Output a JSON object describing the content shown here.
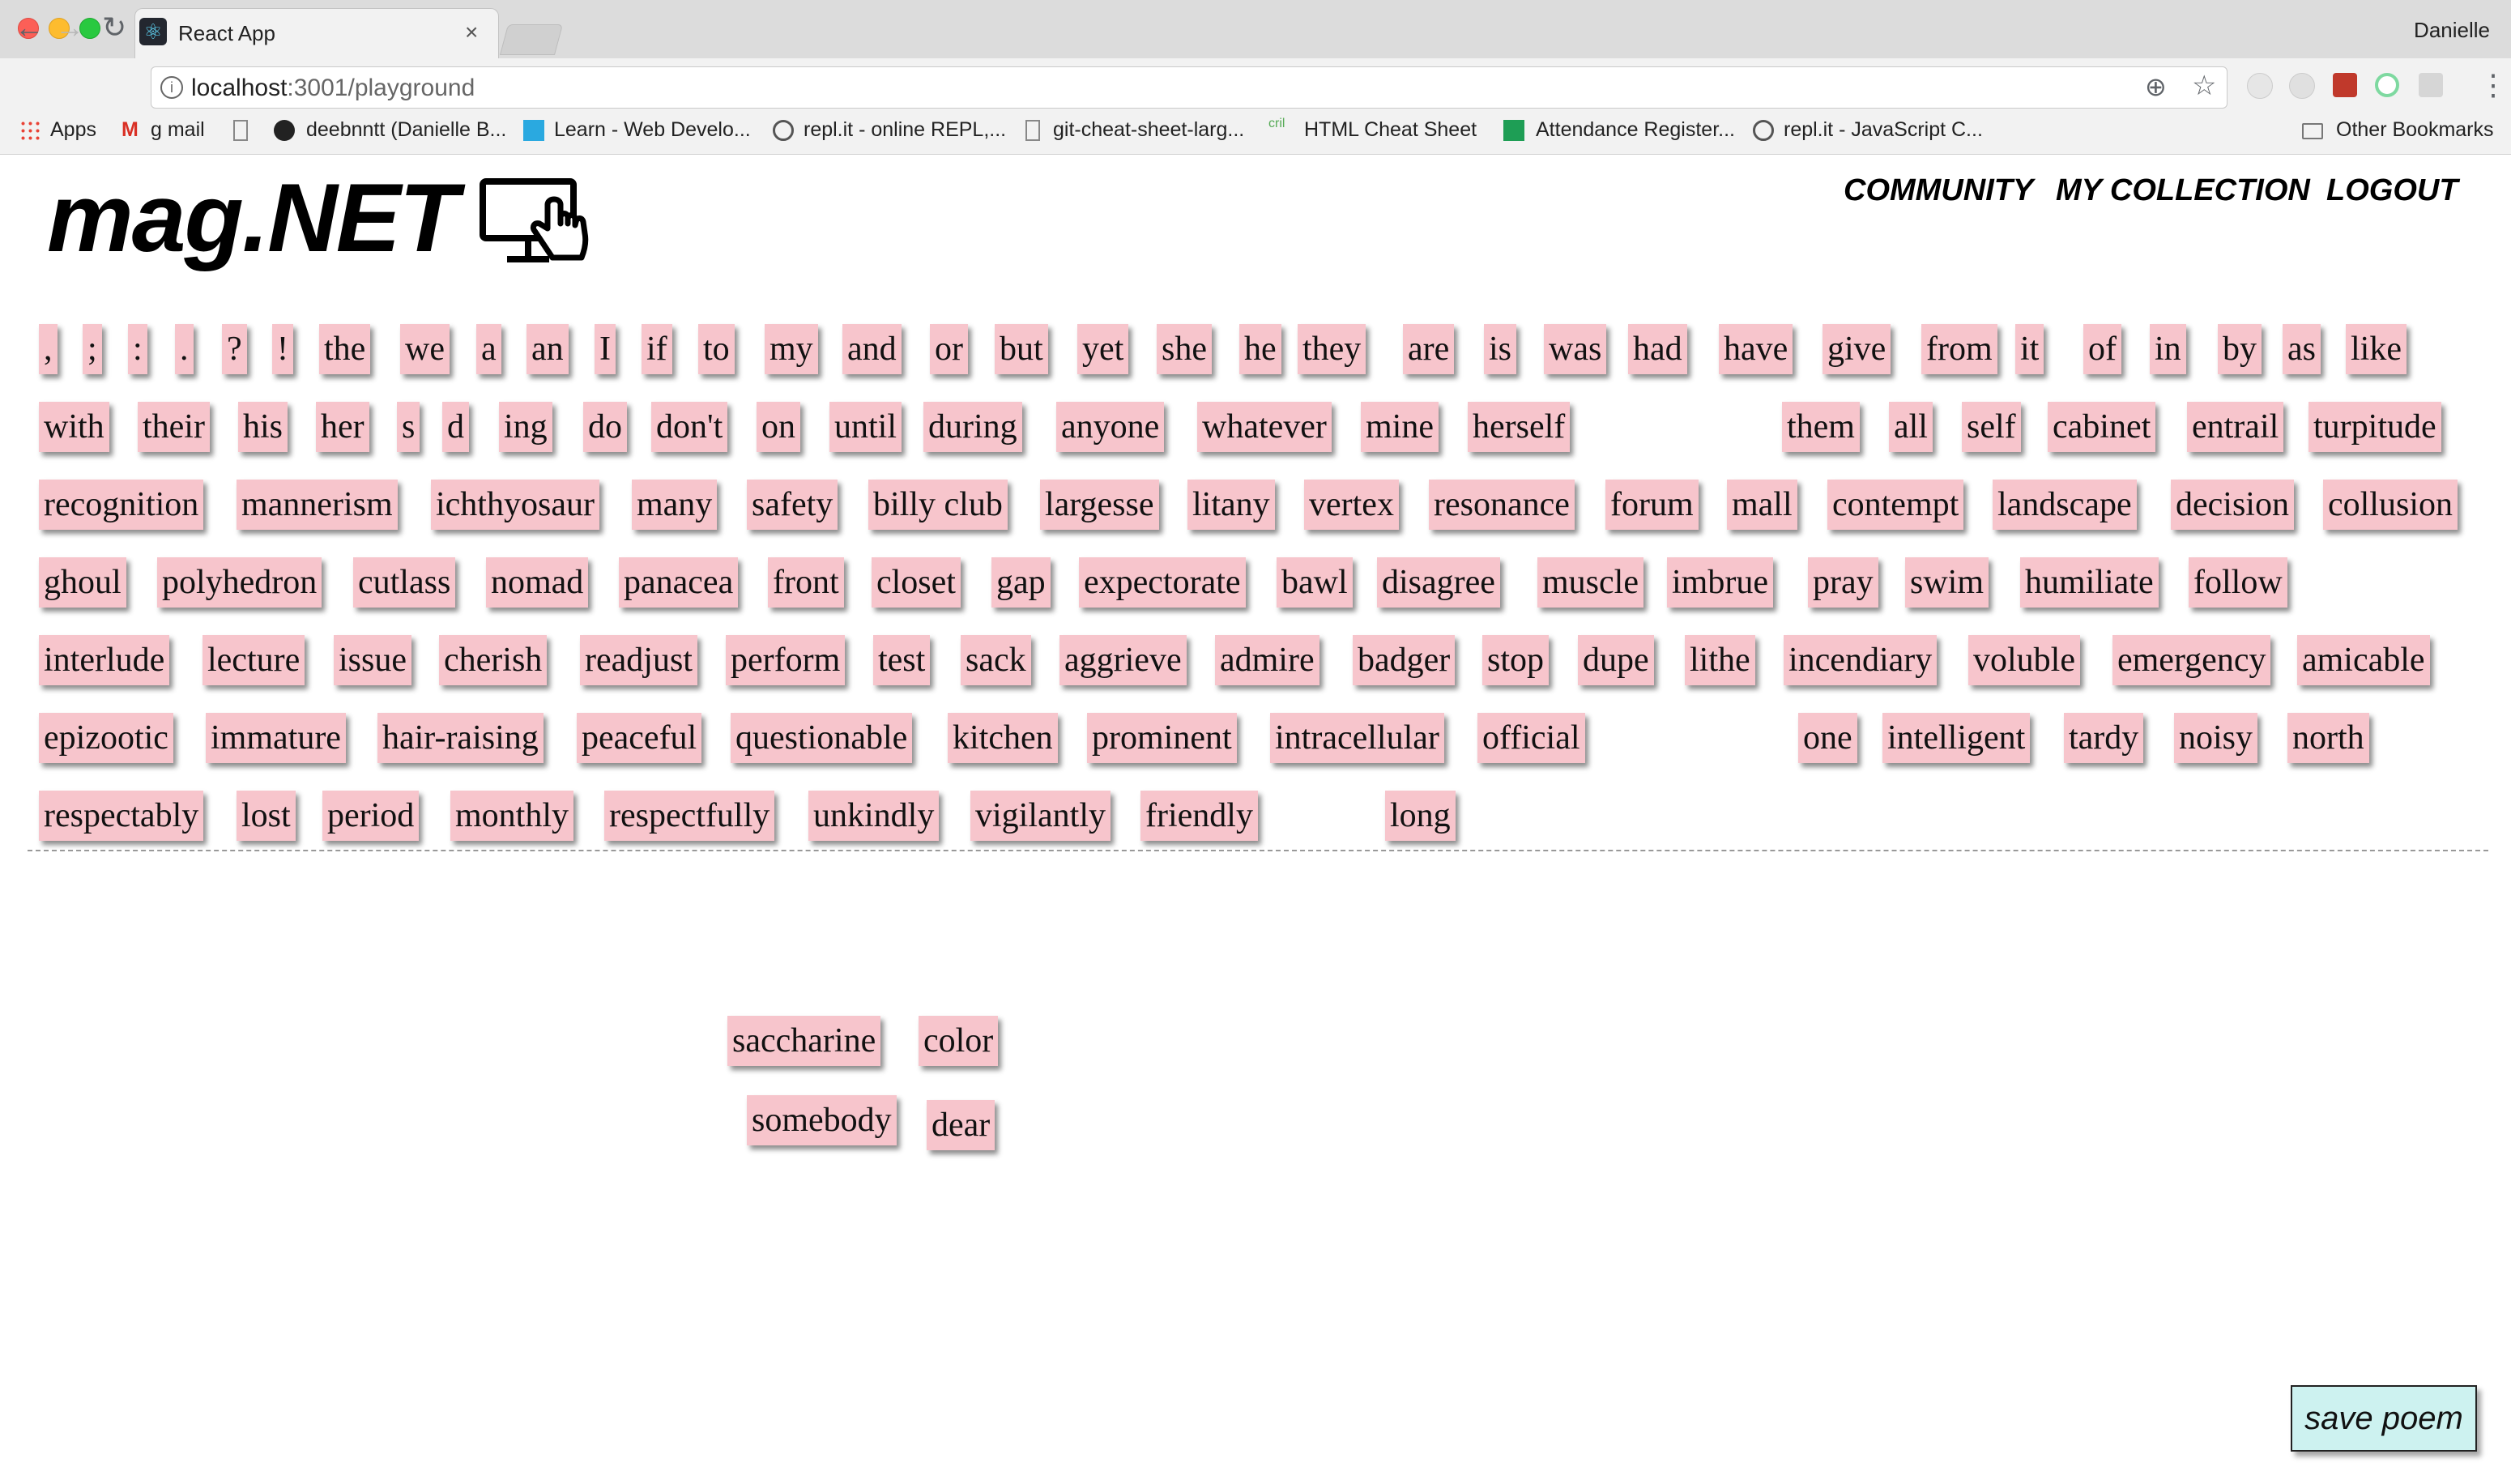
{
  "browser": {
    "tab_title": "React App",
    "tab_close": "×",
    "user": "Danielle",
    "url_host": "localhost",
    "url_path": ":3001/playground",
    "bookmarks": [
      "Apps",
      "g mail",
      "deebnntt (Danielle B...",
      "Learn - Web Develo...",
      "repl.it - online REPL,...",
      "git-cheat-sheet-larg...",
      "HTML Cheat Sheet",
      "Attendance Register...",
      "repl.it - JavaScript C...",
      "Other Bookmarks"
    ]
  },
  "app": {
    "logo": "mag.NET",
    "nav": [
      "COMMUNITY",
      "MY COLLECTION",
      "LOGOUT"
    ],
    "save_label": "save poem"
  },
  "word_bank": [
    [
      ",",
      ";",
      ":",
      ".",
      "?",
      "!",
      "the",
      "we",
      "a",
      "an",
      "I",
      "if",
      "to",
      "my",
      "and",
      "or",
      "but",
      "yet",
      "she",
      "he",
      "they",
      "are",
      "is",
      "was",
      "had",
      "have",
      "give",
      "from",
      "it",
      "of",
      "in",
      "by",
      "as",
      "like"
    ],
    [
      "with",
      "their",
      "his",
      "her",
      "s",
      "d",
      "ing",
      "do",
      "don't",
      "on",
      "until",
      "during",
      "anyone",
      "whatever",
      "mine",
      "herself",
      "them",
      "all",
      "self",
      "cabinet",
      "entrail",
      "turpitude"
    ],
    [
      "recognition",
      "mannerism",
      "ichthyosaur",
      "many",
      "safety",
      "billy club",
      "largesse",
      "litany",
      "vertex",
      "resonance",
      "forum",
      "mall",
      "contempt",
      "landscape",
      "decision",
      "collusion"
    ],
    [
      "ghoul",
      "polyhedron",
      "cutlass",
      "nomad",
      "panacea",
      "front",
      "closet",
      "gap",
      "expectorate",
      "bawl",
      "disagree",
      "muscle",
      "imbrue",
      "pray",
      "swim",
      "humiliate",
      "follow"
    ],
    [
      "interlude",
      "lecture",
      "issue",
      "cherish",
      "readjust",
      "perform",
      "test",
      "sack",
      "aggrieve",
      "admire",
      "badger",
      "stop",
      "dupe",
      "lithe",
      "incendiary",
      "voluble",
      "emergency",
      "amicable"
    ],
    [
      "epizootic",
      "immature",
      "hair-raising",
      "peaceful",
      "questionable",
      "kitchen",
      "prominent",
      "intracellular",
      "official",
      "one",
      "intelligent",
      "tardy",
      "noisy",
      "north"
    ],
    [
      "respectably",
      "lost",
      "period",
      "monthly",
      "respectfully",
      "unkindly",
      "vigilantly",
      "friendly",
      "long"
    ]
  ],
  "poem_words": [
    "saccharine",
    "color",
    "somebody",
    "dear"
  ]
}
